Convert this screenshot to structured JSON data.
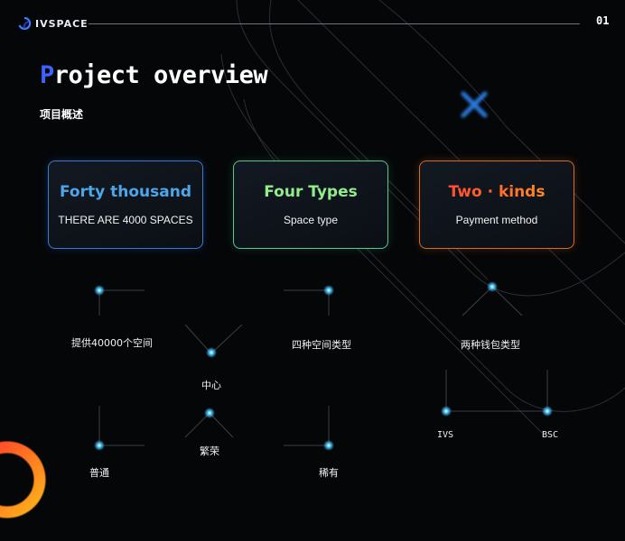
{
  "header": {
    "logo_text": "IVSPACE",
    "page_number": "01"
  },
  "title": {
    "first_letter": "P",
    "rest": "roject overview",
    "subtitle": "项目概述"
  },
  "cards": [
    {
      "heading": "Forty thousand",
      "caption": "THERE ARE 4000 SPACES",
      "accent": "#4da6e8"
    },
    {
      "heading": "Four Types",
      "caption": "Space type",
      "accent": "#92ec8c"
    },
    {
      "heading": "Two · kinds",
      "caption": "Payment method",
      "accent": "#ff7a1a"
    }
  ],
  "diagram_left": {
    "top_left_label": "提供40000个空间",
    "top_right_label": "四种空间类型",
    "center_label": "中心",
    "bottom_center_label": "繁荣",
    "bottom_left_label": "普通",
    "bottom_right_label": "稀有"
  },
  "diagram_right": {
    "top_label": "两种钱包类型",
    "left_label": "IVS",
    "right_label": "BSC"
  },
  "colors": {
    "background": "#050608",
    "accent_blue": "#3a63ff",
    "node_glow": "#49c8ff"
  },
  "icons": [
    "ivspace-logo-icon",
    "close-x-icon"
  ]
}
